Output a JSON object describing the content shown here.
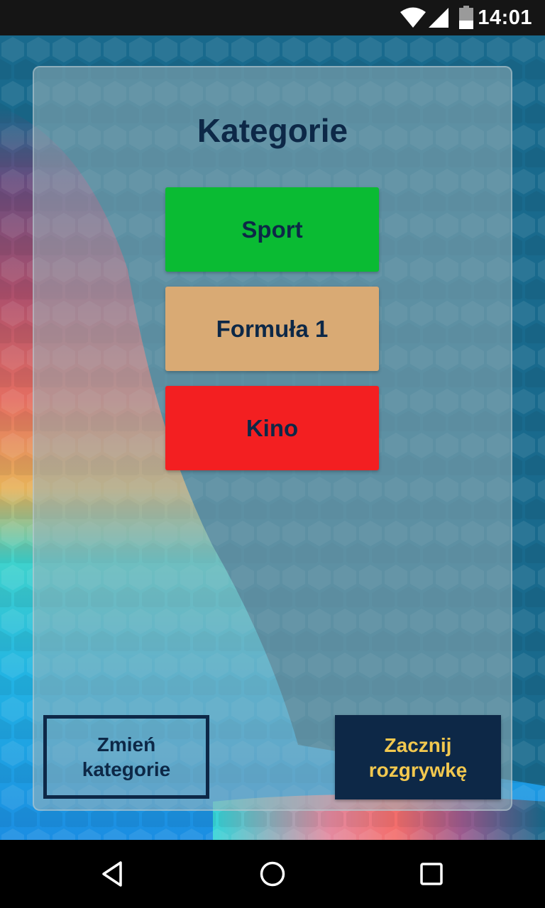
{
  "status_bar": {
    "time": "14:01",
    "icons": [
      "wifi-icon",
      "cellular-signal-icon",
      "battery-icon"
    ]
  },
  "title": "Kategorie",
  "categories": [
    {
      "label": "Sport",
      "color": "#0abb33"
    },
    {
      "label": "Formuła 1",
      "color": "#d9aa74"
    },
    {
      "label": "Kino",
      "color": "#f31f21"
    }
  ],
  "buttons": {
    "change_line1": "Zmień",
    "change_line2": "kategorie",
    "start_line1": "Zacznij",
    "start_line2": "rozgrywkę"
  },
  "colors": {
    "navy": "#0d2847",
    "gold": "#f2c84f",
    "background": "#196a8d"
  },
  "nav_bar": {
    "icons": [
      "back-icon",
      "home-icon",
      "recents-icon"
    ]
  }
}
